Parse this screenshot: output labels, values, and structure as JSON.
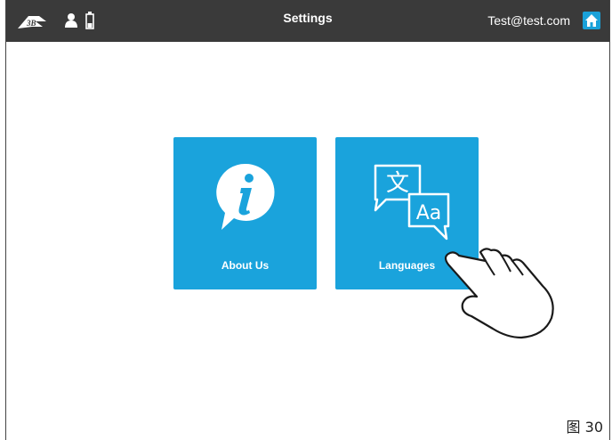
{
  "header": {
    "title": "Settings",
    "email": "Test@test.com",
    "logo_icon": "3b-logo-icon",
    "user_icon": "user-icon",
    "battery_icon": "battery-icon",
    "home_icon": "home-icon"
  },
  "tiles": [
    {
      "label": "About Us",
      "icon": "info-bubble-icon"
    },
    {
      "label": "Languages",
      "icon": "translate-icon",
      "icon_text_1": "文",
      "icon_text_2": "Aa"
    }
  ],
  "figure_label": "图 30",
  "colors": {
    "accent": "#1aa3dc",
    "topbar": "#3a3a3a"
  }
}
